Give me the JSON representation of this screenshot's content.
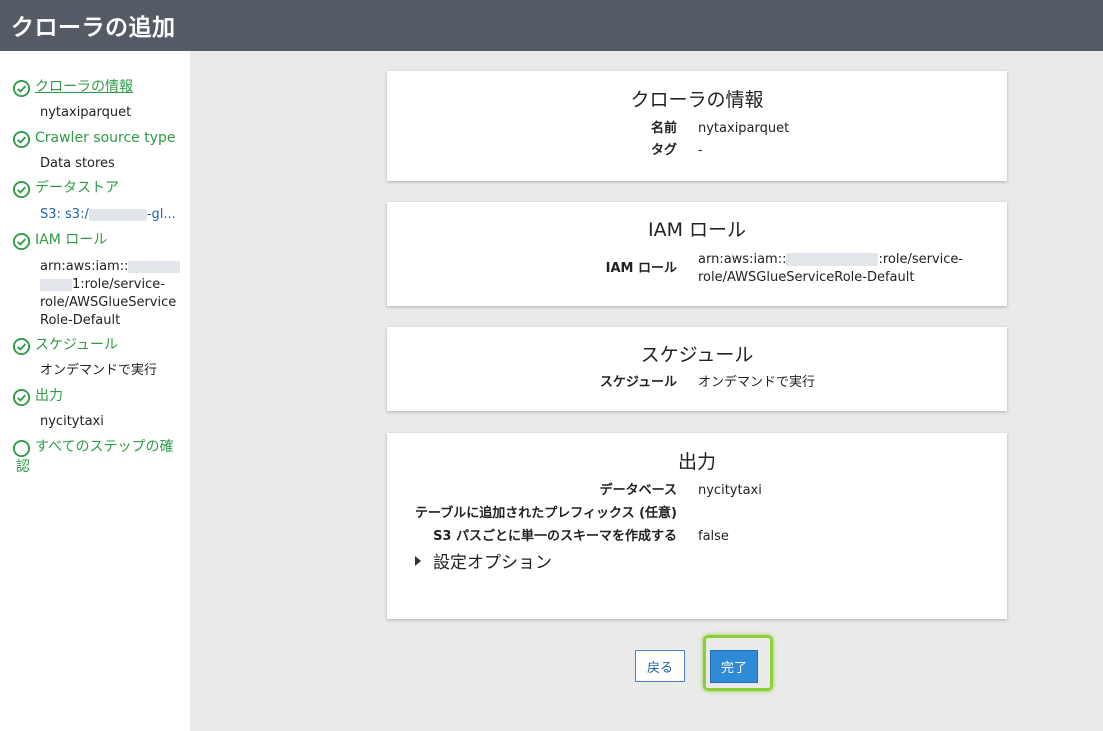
{
  "header": {
    "title": "クローラの追加"
  },
  "sidebar": {
    "steps": [
      {
        "title": "クローラの情報",
        "value": "nytaxiparquet",
        "status": "complete"
      },
      {
        "title": "Crawler source type",
        "value": "Data stores",
        "status": "complete"
      },
      {
        "title": "データストア",
        "value_prefix": "S3: s3:/",
        "value_suffix": "-gl...",
        "status": "complete"
      },
      {
        "title": "IAM ロール",
        "value_line1": "arn:aws:iam::",
        "value_line2": "1:role/service-",
        "value_line3": "role/AWSGlueService",
        "value_line4": "Role-Default",
        "status": "complete"
      },
      {
        "title": "スケジュール",
        "value": "オンデマンドで実行",
        "status": "complete"
      },
      {
        "title": "出力",
        "value": "nycitytaxi",
        "status": "complete"
      },
      {
        "title_line1": "すべてのステップの確",
        "title_line2": "認",
        "status": "pending"
      }
    ]
  },
  "sections": {
    "crawler_info": {
      "title": "クローラの情報",
      "name_label": "名前",
      "name_value": "nytaxiparquet",
      "tag_label": "タグ",
      "tag_value": "-"
    },
    "iam": {
      "title": "IAM ロール",
      "role_label": "IAM ロール",
      "role_line1_prefix": "arn:aws:iam::",
      "role_line1_suffix": ":role/service-",
      "role_line2": "role/AWSGlueServiceRole-Default"
    },
    "schedule": {
      "title": "スケジュール",
      "label": "スケジュール",
      "value": "オンデマンドで実行"
    },
    "output": {
      "title": "出力",
      "db_label": "データベース",
      "db_value": "nycitytaxi",
      "prefix_label": "テーブルに追加されたプレフィックス (任意)",
      "prefix_value": "",
      "single_schema_label": "S3 パスごとに単一のスキーマを作成する",
      "single_schema_value": "false",
      "options_label": "設定オプション"
    }
  },
  "buttons": {
    "back": "戻る",
    "finish": "完了"
  },
  "colors": {
    "accent_green": "#2e9c45",
    "primary_blue": "#2f8ad8",
    "highlight": "#8dcf3b",
    "header_bg": "#545b64"
  }
}
